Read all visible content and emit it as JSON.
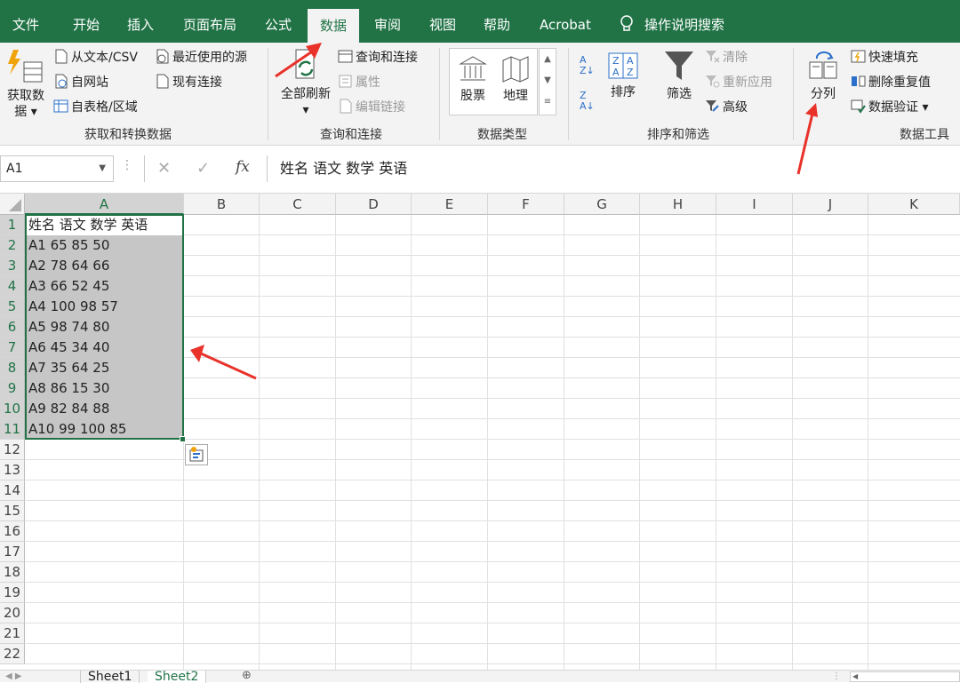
{
  "tabs": [
    "文件",
    "开始",
    "插入",
    "页面布局",
    "公式",
    "数据",
    "审阅",
    "视图",
    "帮助",
    "Acrobat"
  ],
  "active_tab": "数据",
  "tell_me": "操作说明搜索",
  "ribbon": {
    "get_data": {
      "label1": "获取数",
      "label2": "据",
      "from_text": "从文本/CSV",
      "from_web": "自网站",
      "from_table": "自表格/区域",
      "recent_sources": "最近使用的源",
      "existing_connections": "现有连接",
      "group": "获取和转换数据"
    },
    "queries": {
      "refresh_all": "全部刷新",
      "queries_connections": "查询和连接",
      "properties": "属性",
      "edit_links": "编辑链接",
      "group": "查询和连接"
    },
    "data_types": {
      "stocks": "股票",
      "geography": "地理",
      "group": "数据类型"
    },
    "sort_filter": {
      "sort": "排序",
      "filter": "筛选",
      "clear": "清除",
      "reapply": "重新应用",
      "advanced": "高级",
      "group": "排序和筛选"
    },
    "data_tools": {
      "text_to_columns": "分列",
      "flash_fill": "快速填充",
      "remove_duplicates": "删除重复值",
      "data_validation": "数据验证",
      "group": "数据工具"
    }
  },
  "name_box": "A1",
  "formula": "姓名 语文 数学 英语",
  "columns": [
    "A",
    "B",
    "C",
    "D",
    "E",
    "F",
    "G",
    "H",
    "I",
    "J",
    "K"
  ],
  "rows": [
    "1",
    "2",
    "3",
    "4",
    "5",
    "6",
    "7",
    "8",
    "9",
    "10",
    "11",
    "12",
    "13",
    "14",
    "15",
    "16",
    "17",
    "18",
    "19",
    "20",
    "21",
    "22"
  ],
  "cells": [
    "姓名 语文 数学 英语",
    "A1 65 85 50",
    "A2 78 64 66",
    "A3 66 52 45",
    "A4 100 98 57",
    "A5 98 74 80",
    "A6 45 34 40",
    "A7 35 64 25",
    "A8 86 15 30",
    "A9 82 84 88",
    "A10 99 100 85"
  ],
  "sheets": [
    "Sheet1",
    "Sheet2"
  ],
  "active_sheet": "Sheet2",
  "colors": {
    "accent": "#217346",
    "annotation": "#e8322a"
  }
}
